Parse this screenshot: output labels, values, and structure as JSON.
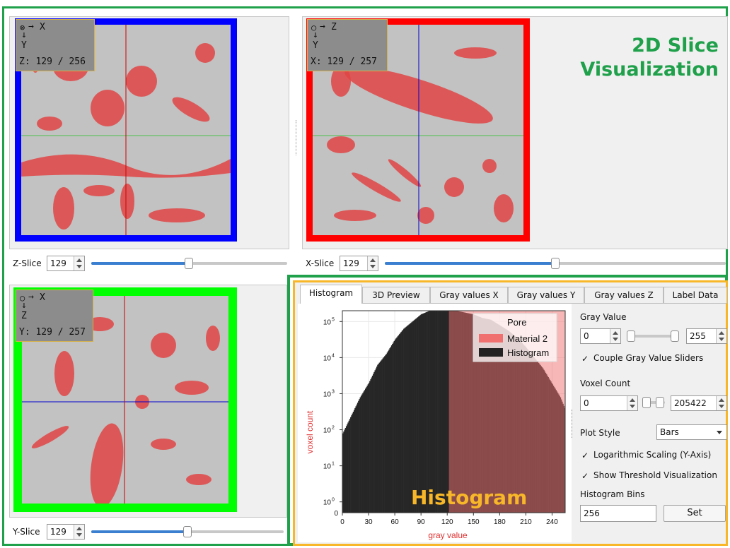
{
  "annotations": {
    "slice_title_line1": "2D Slice",
    "slice_title_line2": "Visualization",
    "histogram_title": "Histogram"
  },
  "views": {
    "z": {
      "info": "Z: 129 / 256",
      "axis_h": "X",
      "axis_v": "Y",
      "label": "Z-Slice",
      "value": "129",
      "slider_fraction": 0.5,
      "border_color": "#0000ff"
    },
    "x": {
      "info": "X: 129 / 257",
      "axis_h": "Z",
      "axis_v": "Y",
      "label": "X-Slice",
      "value": "129",
      "slider_fraction": 0.5,
      "border_color": "#ff0000"
    },
    "y": {
      "info": "Y: 129 / 257",
      "axis_h": "X",
      "axis_v": "Z",
      "label": "Y-Slice",
      "value": "129",
      "slider_fraction": 0.5,
      "border_color": "#00ff00"
    }
  },
  "tabs": [
    {
      "label": "Histogram",
      "active": true
    },
    {
      "label": "3D Preview",
      "active": false
    },
    {
      "label": "Gray values X",
      "active": false
    },
    {
      "label": "Gray values Y",
      "active": false
    },
    {
      "label": "Gray values Z",
      "active": false
    },
    {
      "label": "Label Data",
      "active": false
    }
  ],
  "controls": {
    "gray_value_label": "Gray Value",
    "gray_min": "0",
    "gray_max": "255",
    "couple_label": "Couple Gray Value Sliders",
    "couple_checked": true,
    "voxel_count_label": "Voxel Count",
    "voxel_min": "0",
    "voxel_max": "205422",
    "plot_style_label": "Plot Style",
    "plot_style_value": "Bars",
    "log_label": "Logarithmic Scaling (Y-Axis)",
    "log_checked": true,
    "threshold_label": "Show Threshold Visualization",
    "threshold_checked": true,
    "bins_label": "Histogram Bins",
    "bins_value": "256",
    "set_label": "Set"
  },
  "colors": {
    "green_frame": "#1fa04a",
    "orange_frame": "#f7b728",
    "overlay_red": "#e04545",
    "material2": "#f07070"
  },
  "chart_data": {
    "type": "bar",
    "xlabel": "gray value",
    "ylabel": "voxel count",
    "xlim": [
      0,
      255
    ],
    "ylim_log10": [
      -0.3,
      5.3
    ],
    "log_scale_y": true,
    "x_ticks": [
      0,
      30,
      60,
      90,
      120,
      150,
      180,
      210,
      240
    ],
    "y_tick_labels": [
      {
        "base": "10",
        "exp": "0"
      },
      {
        "base": "10",
        "exp": "1"
      },
      {
        "base": "10",
        "exp": "2"
      },
      {
        "base": "10",
        "exp": "3"
      },
      {
        "base": "10",
        "exp": "4"
      },
      {
        "base": "10",
        "exp": "5"
      }
    ],
    "threshold": 122,
    "legend": [
      "Pore",
      "Material 2",
      "Histogram"
    ],
    "legend_position": "top-right",
    "histogram_log10_samples": {
      "x": [
        0,
        10,
        20,
        30,
        40,
        50,
        60,
        70,
        80,
        90,
        100,
        110,
        120,
        130,
        140,
        150,
        160,
        170,
        180,
        190,
        200,
        210,
        220,
        230,
        240,
        250,
        255
      ],
      "y": [
        1.9,
        2.4,
        2.9,
        3.3,
        3.8,
        4.1,
        4.5,
        4.8,
        5.0,
        5.2,
        5.3,
        5.3,
        5.3,
        5.3,
        5.25,
        5.2,
        5.1,
        5.05,
        4.9,
        4.75,
        4.55,
        4.3,
        4.0,
        3.7,
        3.3,
        2.9,
        2.6
      ]
    }
  }
}
